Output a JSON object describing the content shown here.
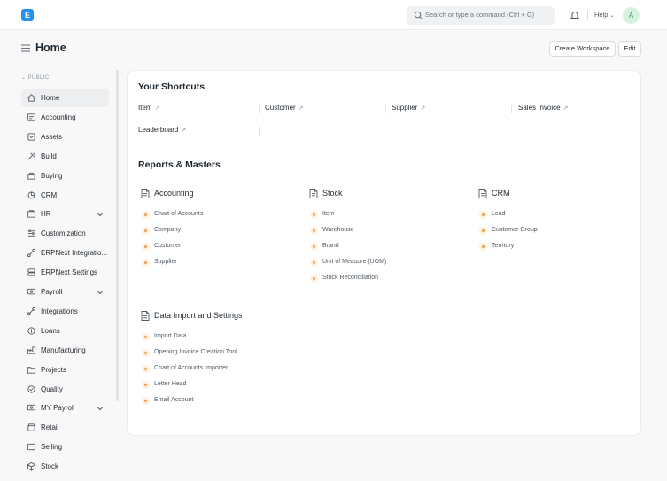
{
  "navbar": {
    "logo_text": "E",
    "search_placeholder": "Search or type a command (Ctrl + G)",
    "help_label": "Help",
    "avatar_initial": "A"
  },
  "header": {
    "title": "Home",
    "create_workspace_label": "Create Workspace",
    "edit_label": "Edit"
  },
  "sidebar": {
    "section_label": "PUBLIC",
    "items": [
      {
        "label": "Home",
        "icon": "home-icon",
        "active": true
      },
      {
        "label": "Accounting",
        "icon": "accounting-icon"
      },
      {
        "label": "Assets",
        "icon": "assets-icon"
      },
      {
        "label": "Build",
        "icon": "tools-icon"
      },
      {
        "label": "Buying",
        "icon": "buying-icon"
      },
      {
        "label": "CRM",
        "icon": "crm-icon"
      },
      {
        "label": "HR",
        "icon": "hr-icon",
        "expandable": true
      },
      {
        "label": "Customization",
        "icon": "customization-icon"
      },
      {
        "label": "ERPNext Integratio...",
        "icon": "integration-icon"
      },
      {
        "label": "ERPNext Settings",
        "icon": "settings-icon"
      },
      {
        "label": "Payroll",
        "icon": "payroll-icon",
        "expandable": true
      },
      {
        "label": "Integrations",
        "icon": "integration-icon"
      },
      {
        "label": "Loans",
        "icon": "loans-icon"
      },
      {
        "label": "Manufacturing",
        "icon": "manufacturing-icon"
      },
      {
        "label": "Projects",
        "icon": "projects-icon"
      },
      {
        "label": "Quality",
        "icon": "quality-icon"
      },
      {
        "label": "MY Payroll",
        "icon": "payroll-icon",
        "expandable": true
      },
      {
        "label": "Retail",
        "icon": "retail-icon"
      },
      {
        "label": "Selling",
        "icon": "selling-icon"
      },
      {
        "label": "Stock",
        "icon": "stock-icon"
      }
    ]
  },
  "shortcuts": {
    "title": "Your Shortcuts",
    "items": [
      "Item",
      "Customer",
      "Supplier",
      "Sales Invoice",
      "Leaderboard"
    ]
  },
  "reports": {
    "title": "Reports & Masters",
    "groups": [
      {
        "title": "Accounting",
        "links": [
          "Chart of Accounts",
          "Company",
          "Customer",
          "Supplier"
        ]
      },
      {
        "title": "Stock",
        "links": [
          "Item",
          "Warehouse",
          "Brand",
          "Unit of Measure (UOM)",
          "Stock Reconciliation"
        ]
      },
      {
        "title": "CRM",
        "links": [
          "Lead",
          "Customer Group",
          "Territory"
        ]
      },
      {
        "title": "Data Import and Settings",
        "links": [
          "Import Data",
          "Opening Invoice Creation Tool",
          "Chart of Accounts Importer",
          "Letter Head",
          "Email Account"
        ]
      }
    ]
  },
  "colors": {
    "accent": "#2490ef",
    "link_dot": "#f0a04b",
    "avatar_bg": "#d6f2e0"
  }
}
